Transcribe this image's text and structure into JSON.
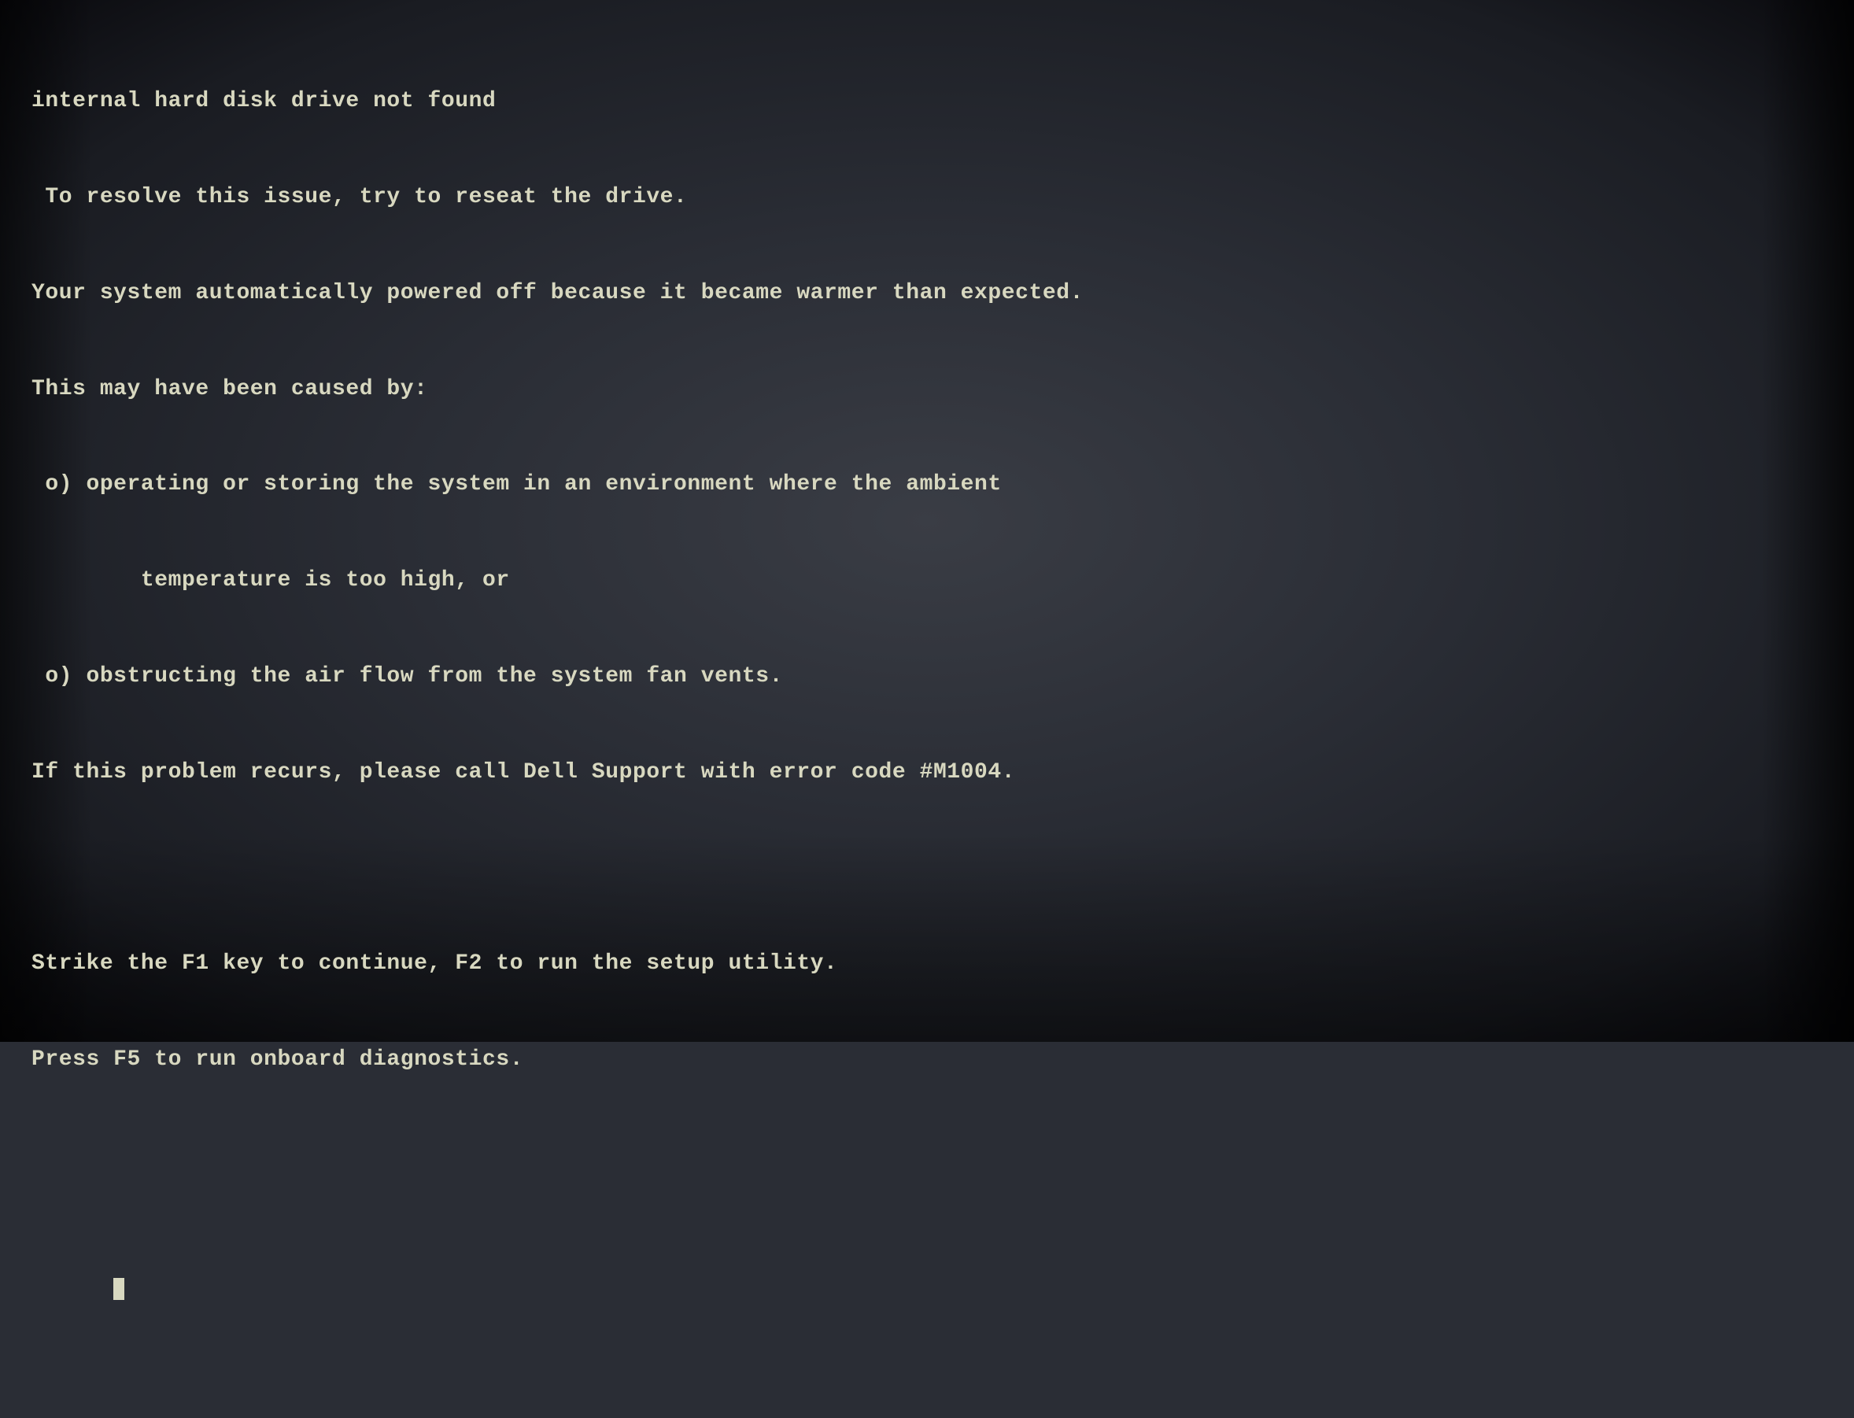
{
  "screen": {
    "background_color": "#2a2d35",
    "text_color": "#d8d8c0"
  },
  "terminal": {
    "lines": [
      "internal hard disk drive not found",
      " To resolve this issue, try to reseat the drive.",
      "Your system automatically powered off because it became warmer than expected.",
      "This may have been caused by:",
      " o) operating or storing the system in an environment where the ambient",
      "        temperature is too high, or",
      " o) obstructing the air flow from the system fan vents.",
      "If this problem recurs, please call Dell Support with error code #M1004.",
      "",
      "Strike the F1 key to continue, F2 to run the setup utility.",
      "Press F5 to run onboard diagnostics.",
      ""
    ],
    "cursor_label": "_"
  }
}
